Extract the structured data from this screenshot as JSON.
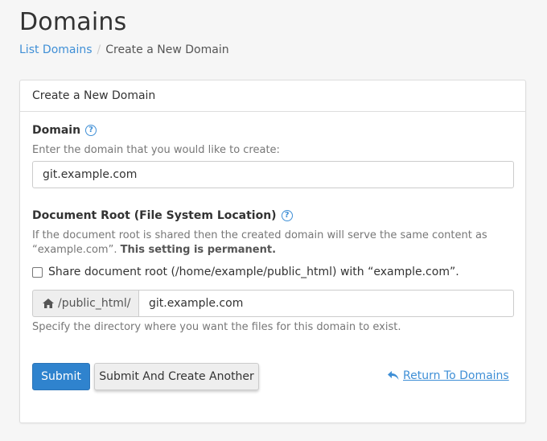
{
  "page": {
    "title": "Domains"
  },
  "breadcrumb": {
    "items": [
      "List Domains",
      "Create a New Domain"
    ],
    "separator": "/"
  },
  "panel": {
    "heading": "Create a New Domain",
    "domain": {
      "label": "Domain",
      "hint": "Enter the domain that you would like to create:",
      "value": "git.example.com"
    },
    "docroot": {
      "label": "Document Root (File System Location)",
      "hint_line1": "If the document root is shared then the created domain will serve the same content as",
      "hint_line2_plain": "“example.com”.",
      "hint_line2_bold": "This setting is permanent.",
      "share_checkbox_label": "Share document root (/home/example/public_html) with “example.com”.",
      "share_checked": false,
      "prefix": "/public_html/",
      "value": "git.example.com",
      "footer_hint": "Specify the directory where you want the files for this domain to exist."
    },
    "actions": {
      "submit": "Submit",
      "submit_another": "Submit And Create Another",
      "return": "Return To Domains"
    }
  },
  "colors": {
    "link": "#3f8fd6",
    "primary": "#2f83ce",
    "background": "#f6f6f6"
  },
  "icons": {
    "help": "question-circle-icon",
    "home": "home-icon",
    "return": "reply-arrow-icon"
  }
}
